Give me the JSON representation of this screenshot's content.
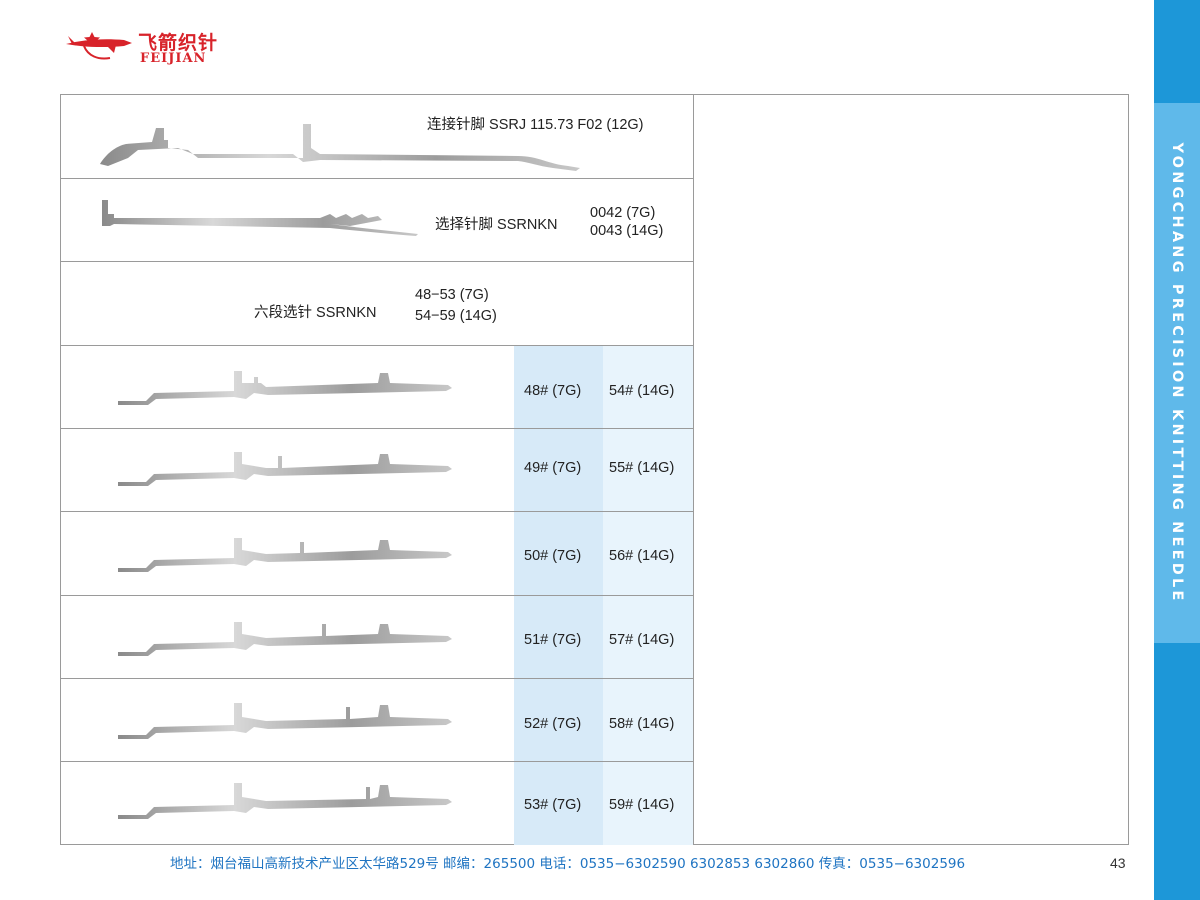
{
  "brand": {
    "name_cn": "飞箭织针",
    "name_en": "FEIJIAN"
  },
  "rows": [
    {
      "name": "连接针脚 SSRJ 115.73 F02  (12G)"
    },
    {
      "name": "选择针脚 SSRNKN",
      "codes": [
        "0042 (7G)",
        "0043 (14G)"
      ]
    },
    {
      "name": "六段选针 SSRNKN",
      "codes": [
        "48−53  (7G)",
        "54−59 (14G)"
      ]
    }
  ],
  "variants": [
    {
      "a": "48# (7G)",
      "b": "54# (14G)"
    },
    {
      "a": "49# (7G)",
      "b": "55# (14G)"
    },
    {
      "a": "50# (7G)",
      "b": "56# (14G)"
    },
    {
      "a": "51# (7G)",
      "b": "57# (14G)"
    },
    {
      "a": "52# (7G)",
      "b": "58# (14G)"
    },
    {
      "a": "53# (7G)",
      "b": "59# (14G)"
    }
  ],
  "sidebar_text": "YONGCHANG PRECISION KNITTING NEEDLE",
  "footer": "地址：烟台福山高新技术产业区太华路529号     邮编：265500     电话：0535−6302590 6302853 6302860     传真：0535−6302596",
  "page_number": "43",
  "colors": {
    "brand_red": "#d8232a",
    "sidebar_blue": "#1d97d8",
    "sidebar_light": "#5fb9ea",
    "cell_blue": "#d7eaf8",
    "cell_light": "#e8f4fc",
    "footer_blue": "#1f74c2"
  }
}
